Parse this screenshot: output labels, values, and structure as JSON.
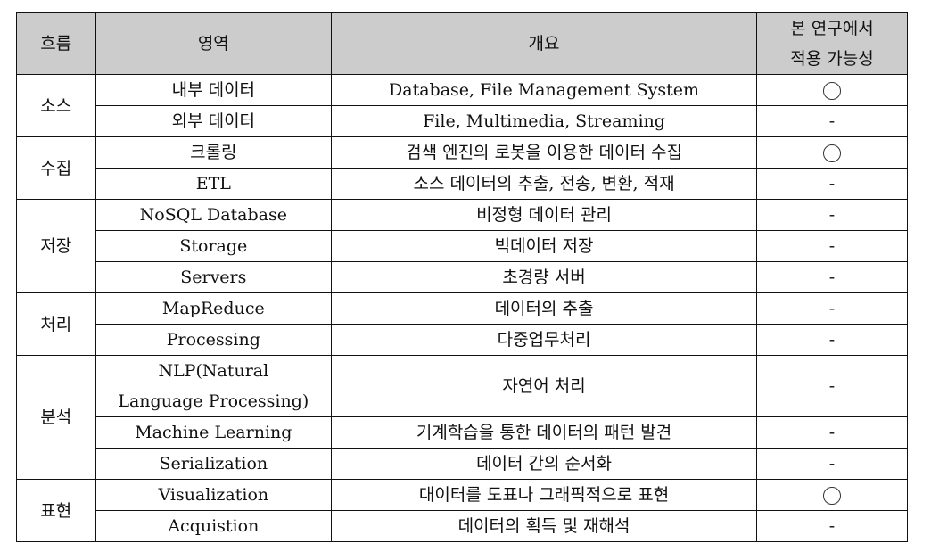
{
  "headers": {
    "flow": "흐름",
    "area": "영역",
    "summary": "개요",
    "applicability_line1": "본 연구에서",
    "applicability_line2": "적용 가능성"
  },
  "symbols": {
    "applicable": "○",
    "not_applicable": "-"
  },
  "groups": [
    {
      "flow": "소스",
      "rows": [
        {
          "area": "내부 데이터",
          "summary": "Database, File Management System",
          "applicable": true
        },
        {
          "area": "외부 데이터",
          "summary": "File, Multimedia, Streaming",
          "applicable": false
        }
      ]
    },
    {
      "flow": "수집",
      "rows": [
        {
          "area": "크롤링",
          "summary": "검색 엔진의 로봇을 이용한 데이터 수집",
          "applicable": true
        },
        {
          "area": "ETL",
          "summary": "소스 데이터의 추출, 전송, 변환, 적재",
          "applicable": false
        }
      ]
    },
    {
      "flow": "저장",
      "rows": [
        {
          "area": "NoSQL Database",
          "summary": "비정형 데이터 관리",
          "applicable": false
        },
        {
          "area": "Storage",
          "summary": "빅데이터 저장",
          "applicable": false
        },
        {
          "area": "Servers",
          "summary": "초경량 서버",
          "applicable": false
        }
      ]
    },
    {
      "flow": "처리",
      "rows": [
        {
          "area": "MapReduce",
          "summary": "데이터의 추출",
          "applicable": false
        },
        {
          "area": "Processing",
          "summary": "다중업무처리",
          "applicable": false
        }
      ]
    },
    {
      "flow": "분석",
      "rows": [
        {
          "area": "NLP(Natural Language Processing)",
          "area_line1": "NLP(Natural",
          "area_line2": "Language Processing)",
          "summary": "자연어 처리",
          "applicable": false
        },
        {
          "area": "Machine Learning",
          "summary": "기계학습을 통한 데이터의 패턴 발견",
          "applicable": false
        },
        {
          "area": "Serialization",
          "summary": "데이터 간의 순서화",
          "applicable": false
        }
      ]
    },
    {
      "flow": "표현",
      "rows": [
        {
          "area": "Visualization",
          "summary": "대이터를 도표나 그래픽적으로 표현",
          "applicable": true
        },
        {
          "area": "Acquistion",
          "summary": "데이터의 획득 및 재해석",
          "applicable": false
        }
      ]
    }
  ]
}
